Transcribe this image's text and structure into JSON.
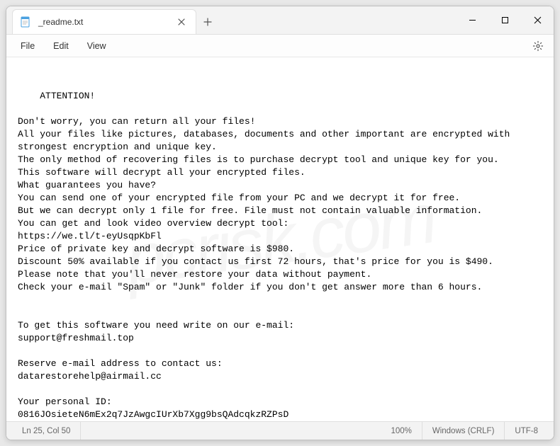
{
  "tab": {
    "title": "_readme.txt"
  },
  "menu": {
    "file": "File",
    "edit": "Edit",
    "view": "View"
  },
  "content": {
    "text": "ATTENTION!\n\nDon't worry, you can return all your files!\nAll your files like pictures, databases, documents and other important are encrypted with strongest encryption and unique key.\nThe only method of recovering files is to purchase decrypt tool and unique key for you.\nThis software will decrypt all your encrypted files.\nWhat guarantees you have?\nYou can send one of your encrypted file from your PC and we decrypt it for free.\nBut we can decrypt only 1 file for free. File must not contain valuable information.\nYou can get and look video overview decrypt tool:\nhttps://we.tl/t-eyUsqpKbFl\nPrice of private key and decrypt software is $980.\nDiscount 50% available if you contact us first 72 hours, that's price for you is $490.\nPlease note that you'll never restore your data without payment.\nCheck your e-mail \"Spam\" or \"Junk\" folder if you don't get answer more than 6 hours.\n\n\nTo get this software you need write on our e-mail:\nsupport@freshmail.top\n\nReserve e-mail address to contact us:\ndatarestorehelp@airmail.cc\n\nYour personal ID:\n0816JOsieteN6mEx2q7JzAwgcIUrXb7Xgg9bsQAdcqkzRZPsD"
  },
  "status": {
    "cursor": "Ln 25, Col 50",
    "zoom": "100%",
    "line_ending": "Windows (CRLF)",
    "encoding": "UTF-8"
  },
  "watermark": "pcrisk.com"
}
